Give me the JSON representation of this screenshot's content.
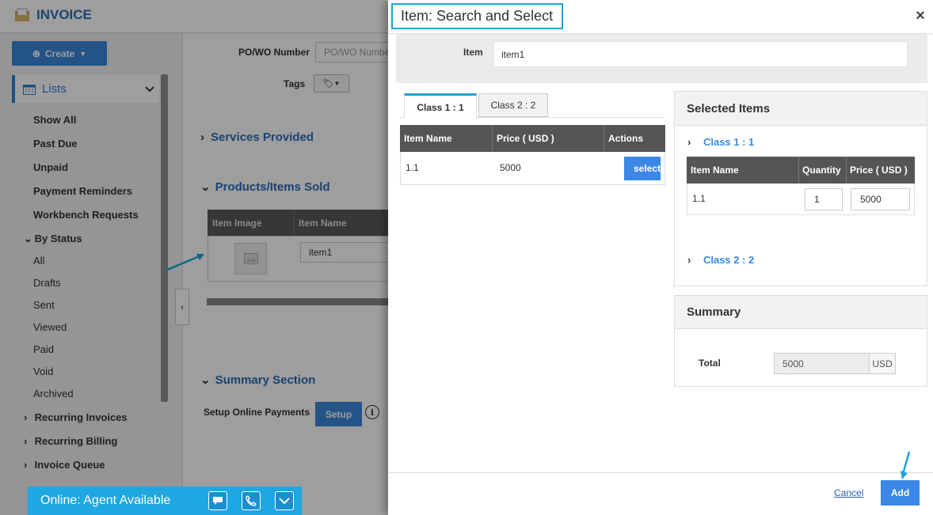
{
  "app": {
    "title": "INVOICE",
    "create_label": "Create",
    "lists_label": "Lists",
    "nav": [
      "Show All",
      "Past Due",
      "Unpaid",
      "Payment Reminders",
      "Workbench Requests"
    ],
    "by_status_label": "By Status",
    "status_items": [
      "All",
      "Drafts",
      "Sent",
      "Viewed",
      "Paid",
      "Void",
      "Archived"
    ],
    "groups": [
      "Recurring Invoices",
      "Recurring Billing",
      "Invoice Queue"
    ]
  },
  "form": {
    "po_label": "PO/WO Number",
    "po_placeholder": "PO/WO Number",
    "tags_label": "Tags",
    "services_title": "Services Provided",
    "products_title": "Products/Items Sold",
    "table_headers": [
      "Item Image",
      "Item Name"
    ],
    "row_item_name": "item1",
    "summary_title": "Summary Section",
    "online_payments_label": "Setup Online Payments",
    "setup_label": "Setup"
  },
  "chat": {
    "status": "Online: Agent Available"
  },
  "modal": {
    "title": "Item: Search and Select",
    "close": "×",
    "item_label": "Item",
    "item_value": "item1",
    "tabs": [
      "Class 1 : 1",
      "Class 2 : 2"
    ],
    "results_headers": [
      "Item Name",
      "Price ( USD )",
      "Actions"
    ],
    "results_rows": [
      {
        "name": "1.1",
        "price": "5000",
        "action": "select"
      }
    ],
    "selected_title": "Selected Items",
    "classes": [
      "Class 1 : 1",
      "Class 2 : 2"
    ],
    "selected_headers": [
      "Item Name",
      "Quantity",
      "Price ( USD )"
    ],
    "selected_rows": [
      {
        "name": "1.1",
        "quantity": "1",
        "price": "5000"
      }
    ],
    "summary_title": "Summary",
    "total_label": "Total",
    "total_value": "5000",
    "currency": "USD",
    "cancel_label": "Cancel",
    "add_label": "Add"
  },
  "colors": {
    "accent": "#1aa3e0",
    "primary_button": "#3a87e8",
    "link": "#3a8ad8",
    "table_header": "#555555"
  }
}
